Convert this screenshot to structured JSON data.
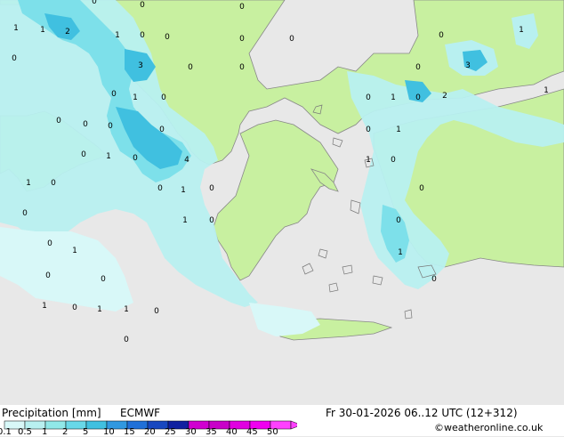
{
  "title": {
    "label": "Precipitation [mm]",
    "model": "ECMWF",
    "valid_time": "Fr 30-01-2026 06..12 UTC (12+312)",
    "credit": "©weatheronline.co.uk"
  },
  "legend": {
    "values": [
      "0.1",
      "0.5",
      "1",
      "2",
      "5",
      "10",
      "15",
      "20",
      "25",
      "30",
      "35",
      "40",
      "45",
      "50"
    ],
    "colors": [
      "#d8f8f8",
      "#b8f0f0",
      "#90e8e8",
      "#68d8e8",
      "#40c0e0",
      "#3098e0",
      "#2070d8",
      "#1848c0",
      "#1020a0",
      "#d000d0",
      "#c800c8",
      "#e000e0",
      "#f000f0",
      "#ff40ff"
    ]
  },
  "map": {
    "colors": {
      "sea": "#e8e8e8",
      "land": "#c8f0a0",
      "coast": "#808080"
    },
    "station_values": [
      "1",
      "1",
      "2",
      "0",
      "0",
      "0",
      "1",
      "0",
      "0",
      "0",
      "0",
      "3",
      "0",
      "0",
      "0",
      "0",
      "3",
      "0",
      "0",
      "2",
      "1",
      "0",
      "0",
      "1",
      "0",
      "1",
      "1",
      "0",
      "0",
      "4",
      "0",
      "0",
      "1",
      "0",
      "0",
      "1",
      "0",
      "1",
      "0",
      "0",
      "0",
      "1",
      "0",
      "0",
      "1",
      "0",
      "0",
      "1",
      "0",
      "0",
      "1",
      "0",
      "1",
      "0",
      "0",
      "1",
      "0",
      "1",
      "1",
      "0",
      "0"
    ]
  }
}
